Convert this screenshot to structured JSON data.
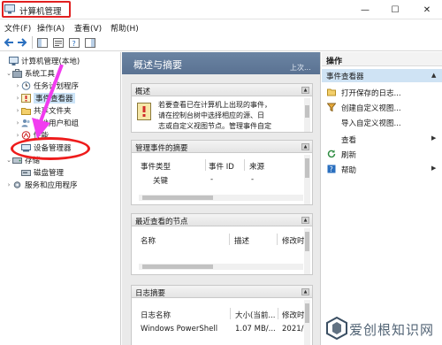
{
  "window": {
    "title": "计算机管理",
    "controls": {
      "minimize": "—",
      "maximize": "☐",
      "close": "✕"
    }
  },
  "menu": [
    "文件(F)",
    "操作(A)",
    "查看(V)",
    "帮助(H)"
  ],
  "tree": {
    "root": "计算机管理(本地)",
    "system_tools": "系统工具",
    "task_scheduler": "任务计划程序",
    "event_viewer": "事件查看器",
    "shared_folders": "共享文件夹",
    "local_users": "本地用户和组",
    "performance": "性能",
    "device_manager": "设备管理器",
    "storage": "存储",
    "disk_management": "磁盘管理",
    "services": "服务和应用程序"
  },
  "middle": {
    "header": "概述与摘要",
    "header_link": "上次...",
    "overview": {
      "title": "概述",
      "lines": [
        "若要查看已在计算机上出现的事件，",
        "请在控制台树中选择相应的源、日",
        "志或自定义视图节点。管理事件自定"
      ]
    },
    "admin_summary": {
      "title": "管理事件的摘要",
      "columns": [
        "事件类型",
        "事件 ID",
        "来源"
      ],
      "rows": [
        [
          "关键",
          "-",
          "-"
        ]
      ]
    },
    "recent_nodes": {
      "title": "最近查看的节点",
      "columns": [
        "名称",
        "描述",
        "修改时"
      ]
    },
    "log_summary": {
      "title": "日志摘要",
      "columns": [
        "日志名称",
        "大小(当前...",
        "修改时"
      ],
      "rows": [
        [
          "Windows PowerShell",
          "1.07 MB/...",
          "2021/"
        ]
      ]
    }
  },
  "actions": {
    "title": "操作",
    "section": "事件查看器",
    "items": [
      {
        "label": "打开保存的日志...",
        "icon": "folder-open-icon"
      },
      {
        "label": "创建自定义视图...",
        "icon": "filter-icon"
      },
      {
        "label": "导入自定义视图...",
        "icon": "import-icon"
      },
      {
        "label": "查看",
        "icon": "none",
        "submenu": true
      },
      {
        "label": "刷新",
        "icon": "refresh-icon"
      },
      {
        "label": "帮助",
        "icon": "help-icon",
        "submenu": true
      }
    ]
  },
  "watermark": {
    "text": "爱创根知识网"
  },
  "colors": {
    "highlight_red": "#e02020",
    "arrow_magenta": "#f23cf0",
    "header_blue": "#5f7898",
    "selection_blue": "#cce4f7"
  }
}
